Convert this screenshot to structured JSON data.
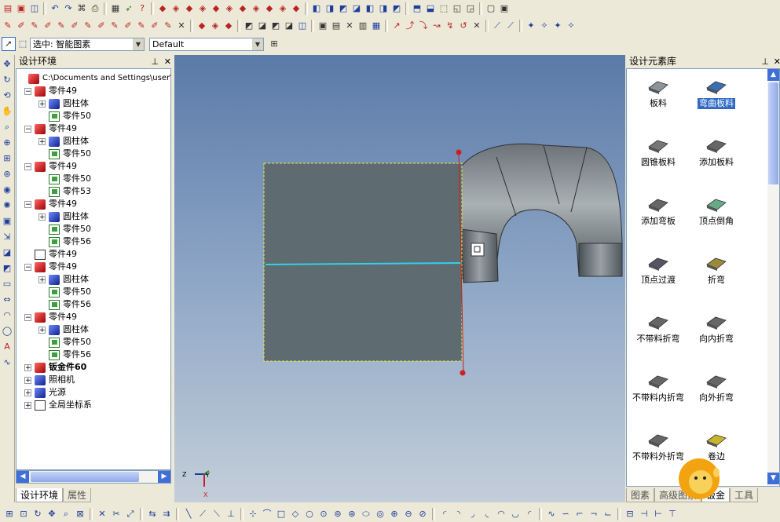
{
  "toolbar": {
    "selection_combo": "选中: 智能图素",
    "style_combo": "Default"
  },
  "left_panel": {
    "title": "设计环境",
    "tree": [
      {
        "label": "C:\\Documents and Settings\\user\\桌",
        "level": 0,
        "icon": "scene-icon",
        "expander": ""
      },
      {
        "label": "零件49",
        "level": 1,
        "icon": "part-icon",
        "expander": "−"
      },
      {
        "label": "圆柱体",
        "level": 2,
        "icon": "cylinder-icon",
        "expander": "+"
      },
      {
        "label": "零件50",
        "level": 2,
        "icon": "subpart-icon",
        "expander": ""
      },
      {
        "label": "零件49",
        "level": 1,
        "icon": "part-icon",
        "expander": "−"
      },
      {
        "label": "圆柱体",
        "level": 2,
        "icon": "cylinder-icon",
        "expander": "+"
      },
      {
        "label": "零件50",
        "level": 2,
        "icon": "subpart-icon",
        "expander": ""
      },
      {
        "label": "零件49",
        "level": 1,
        "icon": "part-icon",
        "expander": "−"
      },
      {
        "label": "零件50",
        "level": 2,
        "icon": "subpart-icon",
        "expander": ""
      },
      {
        "label": "零件53",
        "level": 2,
        "icon": "subpart-icon",
        "expander": ""
      },
      {
        "label": "零件49",
        "level": 1,
        "icon": "part-icon",
        "expander": "−"
      },
      {
        "label": "圆柱体",
        "level": 2,
        "icon": "cylinder-icon",
        "expander": "+"
      },
      {
        "label": "零件50",
        "level": 2,
        "icon": "subpart-icon",
        "expander": ""
      },
      {
        "label": "零件56",
        "level": 2,
        "icon": "subpart-icon",
        "expander": ""
      },
      {
        "label": "零件49",
        "level": 1,
        "icon": "outline-part-icon",
        "expander": ""
      },
      {
        "label": "零件49",
        "level": 1,
        "icon": "part-icon",
        "expander": "−"
      },
      {
        "label": "圆柱体",
        "level": 2,
        "icon": "cylinder-icon",
        "expander": "+"
      },
      {
        "label": "零件50",
        "level": 2,
        "icon": "subpart-icon",
        "expander": ""
      },
      {
        "label": "零件56",
        "level": 2,
        "icon": "subpart-icon",
        "expander": ""
      },
      {
        "label": "零件49",
        "level": 1,
        "icon": "part-icon",
        "expander": "−"
      },
      {
        "label": "圆柱体",
        "level": 2,
        "icon": "cylinder-icon",
        "expander": "+"
      },
      {
        "label": "零件50",
        "level": 2,
        "icon": "subpart-icon",
        "expander": ""
      },
      {
        "label": "零件56",
        "level": 2,
        "icon": "subpart-icon",
        "expander": ""
      },
      {
        "label": "钣金件60",
        "level": 0,
        "icon": "sheetmetal-icon",
        "expander": "+",
        "bold": true
      },
      {
        "label": "照相机",
        "level": 0,
        "icon": "camera-icon",
        "expander": "+"
      },
      {
        "label": "光源",
        "level": 0,
        "icon": "light-icon",
        "expander": "+"
      },
      {
        "label": "全局坐标系",
        "level": 0,
        "icon": "axes-icon",
        "expander": "+"
      }
    ],
    "tabs": [
      "设计环境",
      "属性"
    ]
  },
  "right_panel": {
    "title": "设计元素库",
    "elements": [
      {
        "label": "板料",
        "icon": "plate-icon",
        "selected": false
      },
      {
        "label": "弯曲板料",
        "icon": "bent-plate-icon",
        "selected": true
      },
      {
        "label": "圆锥板料",
        "icon": "cone-plate-icon",
        "selected": false
      },
      {
        "label": "添加板料",
        "icon": "add-plate-icon",
        "selected": false
      },
      {
        "label": "添加弯板",
        "icon": "add-bend-plate-icon",
        "selected": false
      },
      {
        "label": "顶点倒角",
        "icon": "vertex-chamfer-icon",
        "selected": false
      },
      {
        "label": "顶点过渡",
        "icon": "vertex-blend-icon",
        "selected": false
      },
      {
        "label": "折弯",
        "icon": "bend-icon",
        "selected": false
      },
      {
        "label": "不带料折弯",
        "icon": "bend-no-material-icon",
        "selected": false
      },
      {
        "label": "向内折弯",
        "icon": "inward-bend-icon",
        "selected": false
      },
      {
        "label": "不带料内折弯",
        "icon": "inner-bend-no-material-icon",
        "selected": false
      },
      {
        "label": "向外折弯",
        "icon": "outward-bend-icon",
        "selected": false
      },
      {
        "label": "不带料外折弯",
        "icon": "outer-bend-no-material-icon",
        "selected": false
      },
      {
        "label": "卷边",
        "icon": "hem-icon",
        "selected": false
      }
    ],
    "tabs": [
      "图素",
      "高级图素",
      "钣金",
      "工具"
    ]
  },
  "viewport": {
    "axis_labels": {
      "z": "Z",
      "y": "Y",
      "x": "X"
    }
  }
}
